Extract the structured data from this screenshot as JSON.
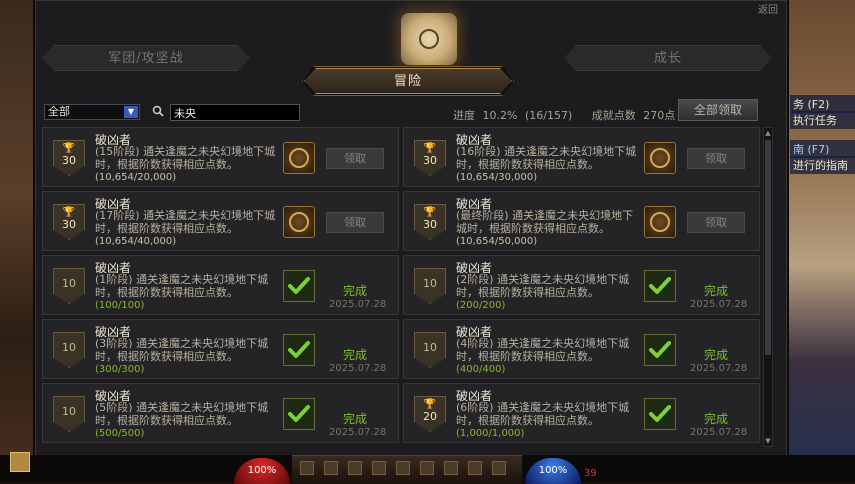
{
  "window": {
    "close_label": "返回"
  },
  "tabs": {
    "left": "军团/攻坚战",
    "active": "冒险",
    "right": "成长"
  },
  "filter": {
    "category_selected": "全部",
    "search_value": "未央"
  },
  "progress": {
    "label": "进度",
    "percent": "10.2%",
    "fraction": "(16/157)",
    "points_label": "成就点数",
    "points_value": "270点"
  },
  "claim_all_label": "全部领取",
  "achievements": [
    {
      "title": "破凶者",
      "desc": "(15阶段) 通关逢魔之未央幻境地下城时，根据阶数获得相应点数。",
      "progress": "(10,654/20,000)",
      "points": "30",
      "trophy": true,
      "status": "claim",
      "button": "领取"
    },
    {
      "title": "破凶者",
      "desc": "(16阶段) 通关逢魔之未央幻境地下城时，根据阶数获得相应点数。",
      "progress": "(10,654/30,000)",
      "points": "30",
      "trophy": true,
      "status": "claim",
      "button": "领取"
    },
    {
      "title": "破凶者",
      "desc": "(17阶段) 通关逢魔之未央幻境地下城时，根据阶数获得相应点数。",
      "progress": "(10,654/40,000)",
      "points": "30",
      "trophy": true,
      "status": "claim",
      "button": "领取"
    },
    {
      "title": "破凶者",
      "desc": "(最终阶段) 通关逢魔之未央幻境地下城时，根据阶数获得相应点数。",
      "progress": "(10,654/50,000)",
      "points": "30",
      "trophy": true,
      "status": "claim",
      "button": "领取"
    },
    {
      "title": "破凶者",
      "desc": "(1阶段) 通关逢魔之未央幻境地下城时，根据阶数获得相应点数。",
      "progress": "(100/100)",
      "points": "10",
      "trophy": false,
      "status": "done",
      "done": "完成",
      "date": "2025.07.28"
    },
    {
      "title": "破凶者",
      "desc": "(2阶段) 通关逢魔之未央幻境地下城时，根据阶数获得相应点数。",
      "progress": "(200/200)",
      "points": "10",
      "trophy": false,
      "status": "done",
      "done": "完成",
      "date": "2025.07.28"
    },
    {
      "title": "破凶者",
      "desc": "(3阶段) 通关逢魔之未央幻境地下城时，根据阶数获得相应点数。",
      "progress": "(300/300)",
      "points": "10",
      "trophy": false,
      "status": "done",
      "done": "完成",
      "date": "2025.07.28"
    },
    {
      "title": "破凶者",
      "desc": "(4阶段) 通关逢魔之未央幻境地下城时，根据阶数获得相应点数。",
      "progress": "(400/400)",
      "points": "10",
      "trophy": false,
      "status": "done",
      "done": "完成",
      "date": "2025.07.28"
    },
    {
      "title": "破凶者",
      "desc": "(5阶段) 通关逢魔之未央幻境地下城时，根据阶数获得相应点数。",
      "progress": "(500/500)",
      "points": "10",
      "trophy": false,
      "status": "done",
      "done": "完成",
      "date": "2025.07.28"
    },
    {
      "title": "破凶者",
      "desc": "(6阶段) 通关逢魔之未央幻境地下城时，根据阶数获得相应点数。",
      "progress": "(1,000/1,000)",
      "points": "20",
      "trophy": true,
      "status": "done",
      "done": "完成",
      "date": "2025.07.28"
    }
  ],
  "side_panel": {
    "line1": "务 (F2)",
    "line2": "执行任务",
    "line3": "南 (F7)",
    "line4": "进行的指南",
    "text_color": "#9fd0ff"
  },
  "hud": {
    "hp": "100%",
    "mp": "100%",
    "level": "39"
  },
  "colors": {
    "done_green": "#7cbf2a",
    "accent_gold": "#b08a55"
  }
}
